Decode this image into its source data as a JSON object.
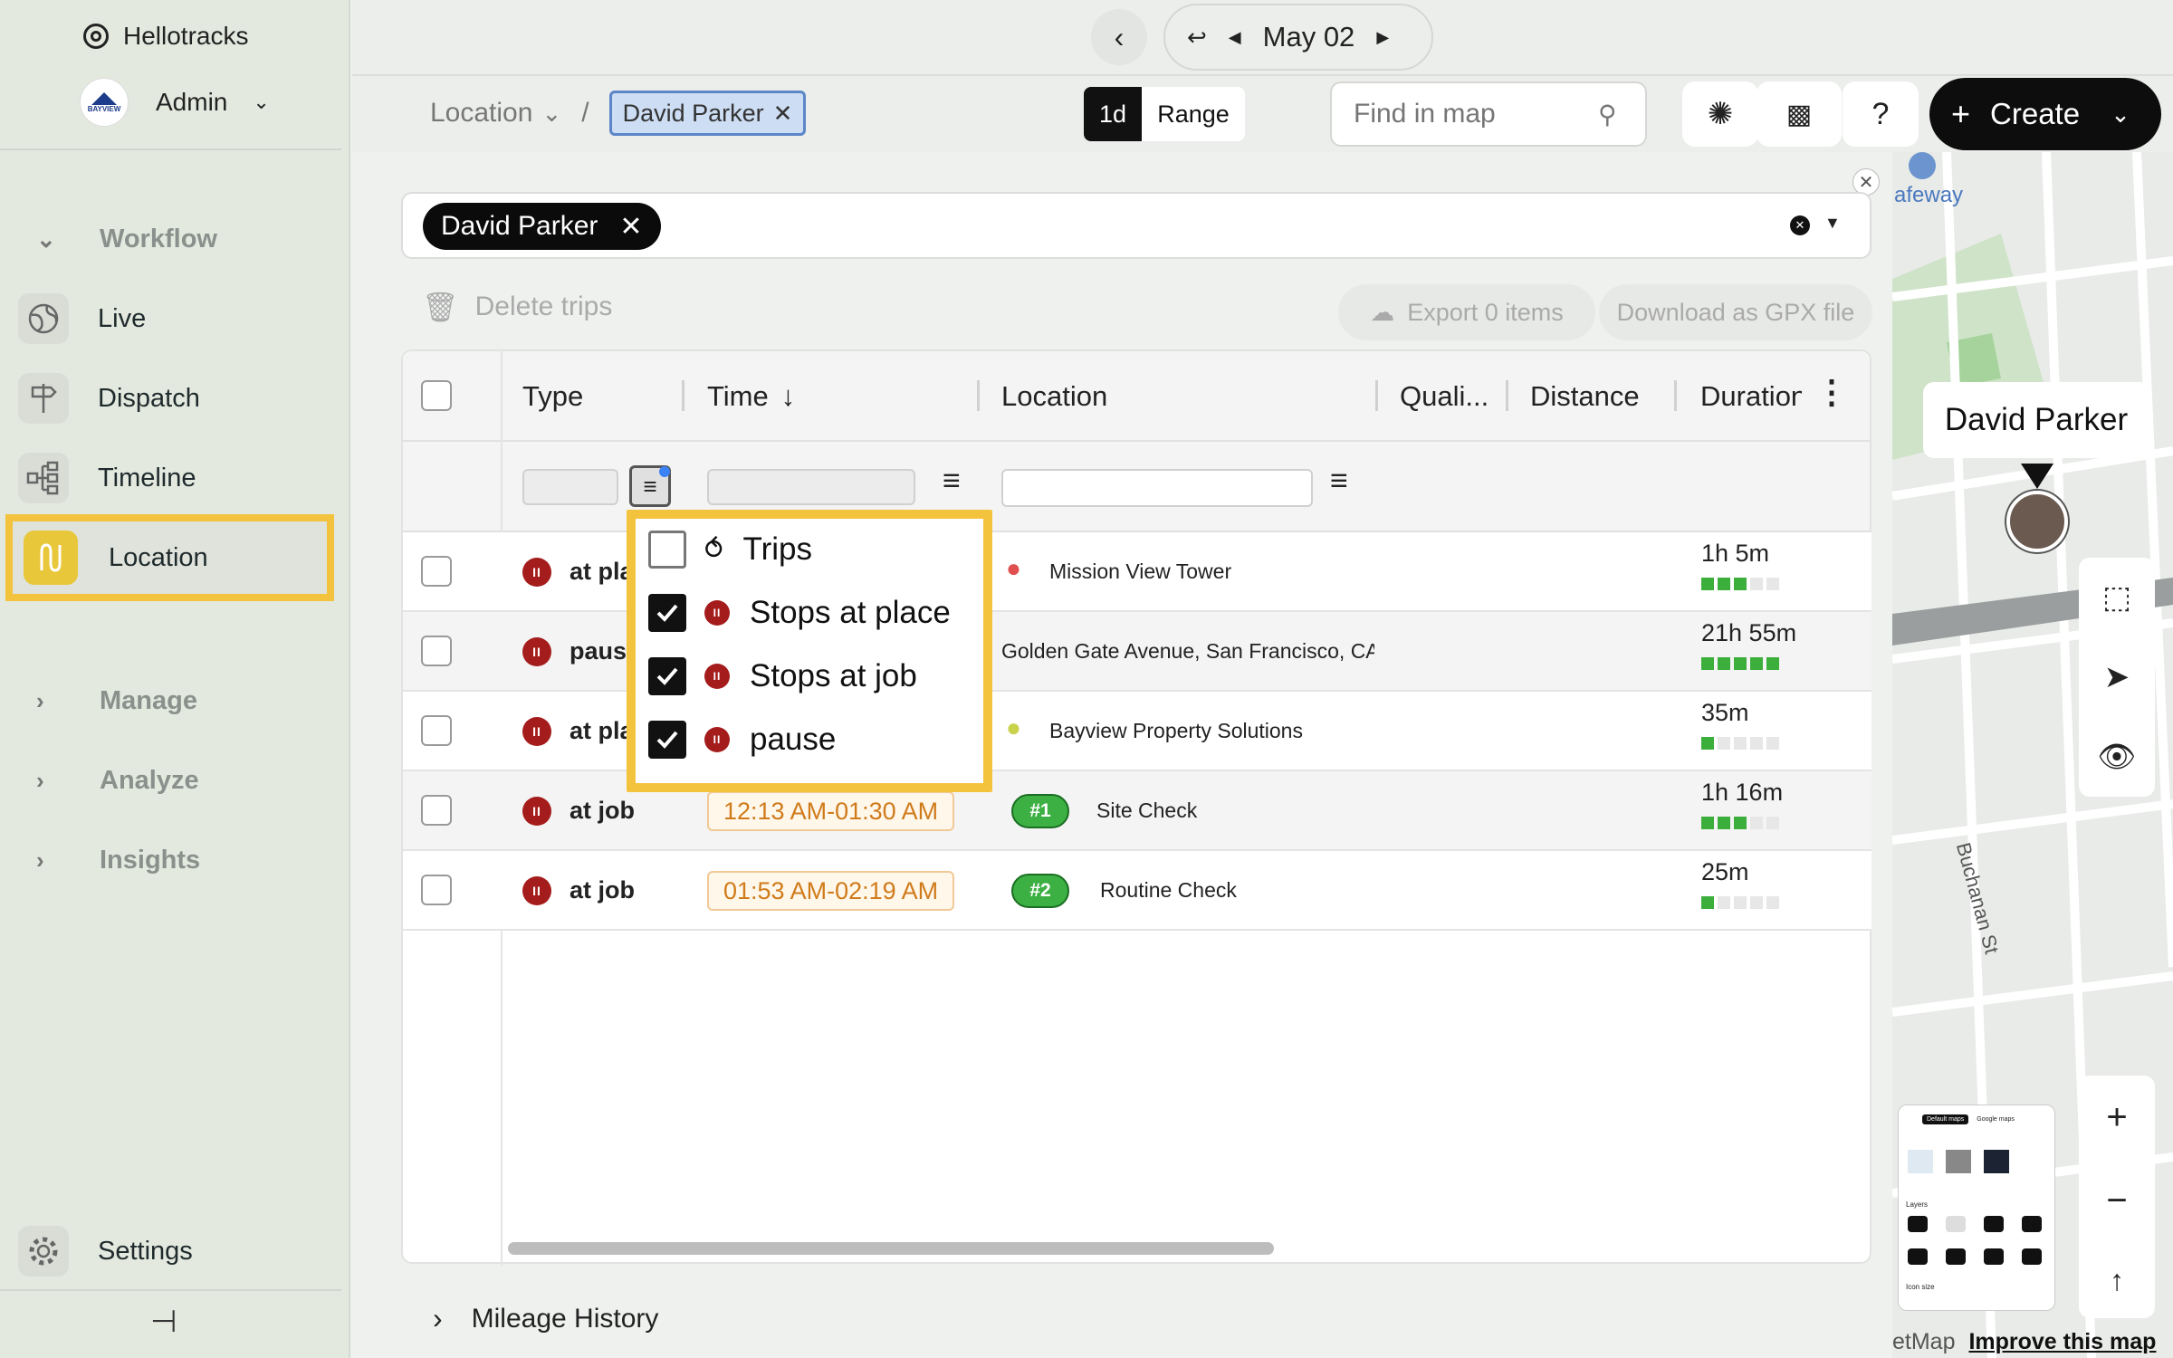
{
  "sidebar": {
    "app_name": "Hellotracks",
    "account": "Admin",
    "logo_text": "BAYVIEW",
    "sections": {
      "workflow": "Workflow",
      "manage": "Manage",
      "analyze": "Analyze",
      "insights": "Insights"
    },
    "items": [
      {
        "label": "Live",
        "icon": "globe-icon"
      },
      {
        "label": "Dispatch",
        "icon": "signpost-icon"
      },
      {
        "label": "Timeline",
        "icon": "timeline-icon"
      },
      {
        "label": "Location",
        "icon": "route-icon",
        "active": true
      }
    ],
    "settings": "Settings",
    "accent": "#f4c33d"
  },
  "topbar": {
    "date": "May 02",
    "breadcrumb_root": "Location",
    "breadcrumb_sep": "/",
    "breadcrumb_chip": "David Parker",
    "mode_1d": "1d",
    "mode_range": "Range",
    "search_placeholder": "Find in map",
    "help": "?",
    "create": "Create"
  },
  "filter": {
    "chip": "David Parker"
  },
  "actions": {
    "delete": "Delete trips",
    "export": "Export 0 items",
    "gpx": "Download as GPX file"
  },
  "table": {
    "headers": {
      "type": "Type",
      "time": "Time",
      "location": "Location",
      "quality": "Quali...",
      "distance": "Distance",
      "duration": "Duration"
    },
    "rows": [
      {
        "type": "at place",
        "time": "",
        "location": "Mission View Tower",
        "duration": "1h 5m",
        "level": 3
      },
      {
        "type": "pause",
        "time": "",
        "location": "Golden Gate Avenue, San Francisco, CA",
        "duration": "21h 55m",
        "level": 5
      },
      {
        "type": "at place",
        "time": "",
        "location": "Bayview Property Solutions",
        "duration": "35m",
        "level": 1
      },
      {
        "type": "at job",
        "time": "12:13 AM-01:30 AM",
        "badge": "#1",
        "location": "Site Check",
        "duration": "1h 16m",
        "level": 3
      },
      {
        "type": "at job",
        "time": "01:53 AM-02:19 AM",
        "badge": "#2",
        "location": "Routine Check",
        "duration": "25m",
        "level": 1
      }
    ]
  },
  "dropdown": {
    "items": [
      {
        "label": "Trips",
        "checked": false
      },
      {
        "label": "Stops at place",
        "checked": true
      },
      {
        "label": "Stops at job",
        "checked": true
      },
      {
        "label": "pause",
        "checked": true
      }
    ]
  },
  "mileage": "Mileage History",
  "map": {
    "person": "David Parker",
    "street": "Buchanan St",
    "poi": "afeway",
    "attribution": "etMap",
    "improve": "Improve this map",
    "mini_tabs": [
      "Default maps",
      "Google maps"
    ],
    "mini_layers": "Layers",
    "mini_icon_size": "Icon size"
  }
}
